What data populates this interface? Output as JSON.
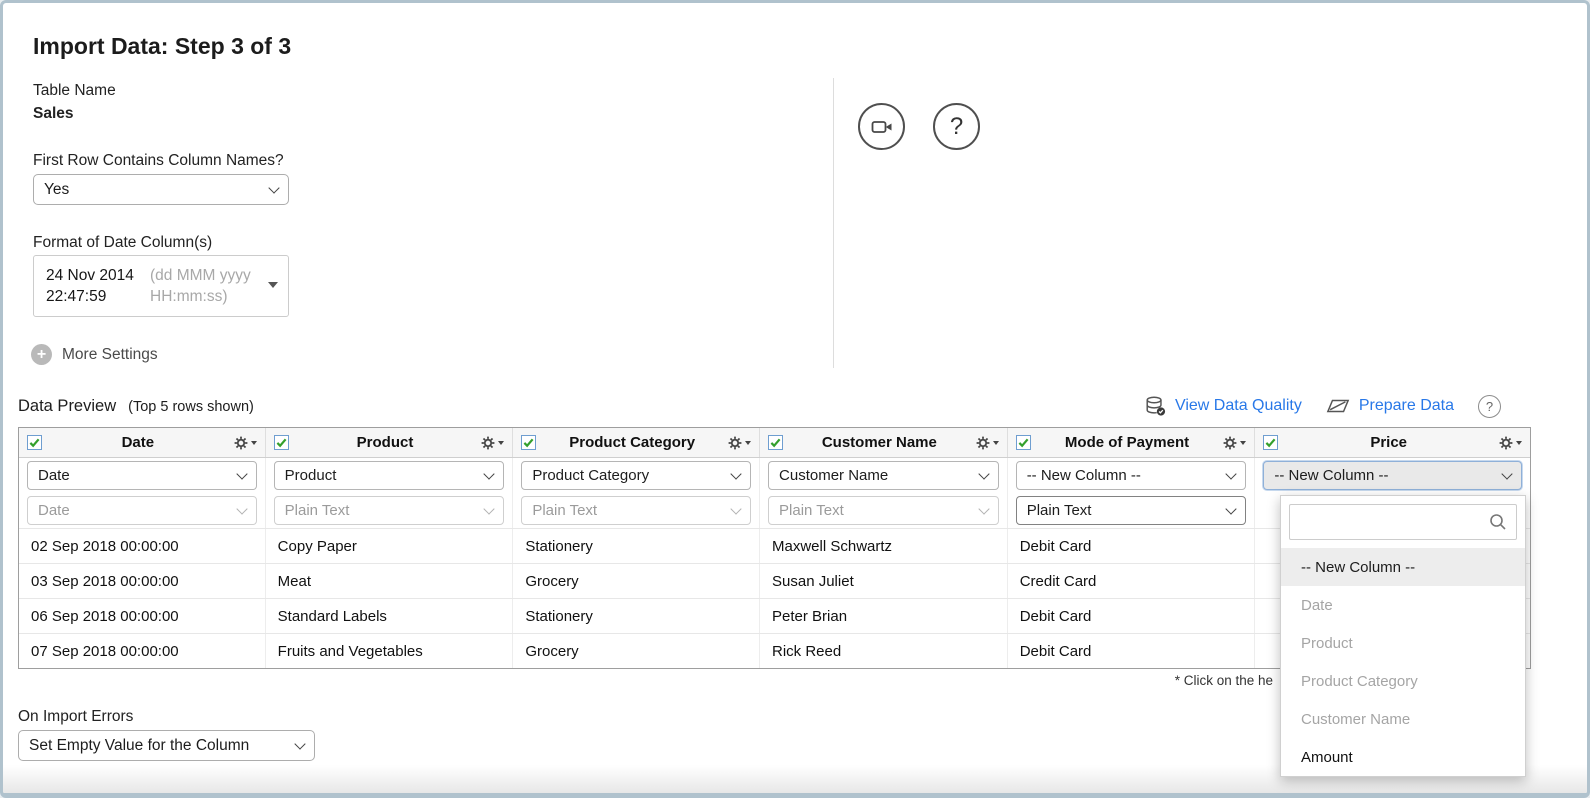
{
  "page": {
    "title": "Import Data: Step 3 of 3"
  },
  "settings": {
    "table_name_label": "Table Name",
    "table_name_value": "Sales",
    "first_row_label": "First Row Contains Column Names?",
    "first_row_value": "Yes",
    "date_format_label": "Format of Date Column(s)",
    "date_value_line1": "24 Nov 2014",
    "date_value_line2": "22:47:59",
    "date_pattern_line1": "(dd MMM yyyy",
    "date_pattern_line2": "HH:mm:ss)",
    "more_settings_label": "More Settings"
  },
  "help": {
    "question_mark": "?",
    "small_question_mark": "?"
  },
  "preview": {
    "title": "Data Preview",
    "subtitle": "(Top 5 rows shown)",
    "view_data_quality_label": "View Data Quality",
    "prepare_data_label": "Prepare Data",
    "footnote": "* Click on the he"
  },
  "table": {
    "columns": [
      {
        "title": "Date",
        "mapping": "Date",
        "type": "Date"
      },
      {
        "title": "Product",
        "mapping": "Product",
        "type": "Plain Text"
      },
      {
        "title": "Product Category",
        "mapping": "Product Category",
        "type": "Plain Text"
      },
      {
        "title": "Customer Name",
        "mapping": "Customer Name",
        "type": "Plain Text"
      },
      {
        "title": "Mode of Payment",
        "mapping": "-- New Column --",
        "type": "Plain Text"
      },
      {
        "title": "Price",
        "mapping": "-- New Column --",
        "type": ""
      }
    ],
    "rows": [
      [
        "02 Sep 2018 00:00:00",
        "Copy Paper",
        "Stationery",
        "Maxwell Schwartz",
        "Debit Card",
        ""
      ],
      [
        "03 Sep 2018 00:00:00",
        "Meat",
        "Grocery",
        "Susan Juliet",
        "Credit Card",
        ""
      ],
      [
        "06 Sep 2018 00:00:00",
        "Standard Labels",
        "Stationery",
        "Peter Brian",
        "Debit Card",
        ""
      ],
      [
        "07 Sep 2018 00:00:00",
        "Fruits and Vegetables",
        "Grocery",
        "Rick Reed",
        "Debit Card",
        ""
      ]
    ]
  },
  "dropdown": {
    "search_value": "",
    "options": [
      {
        "label": "-- New Column --",
        "state": "selected"
      },
      {
        "label": "Date",
        "state": "disabled"
      },
      {
        "label": "Product",
        "state": "disabled"
      },
      {
        "label": "Product Category",
        "state": "disabled"
      },
      {
        "label": "Customer Name",
        "state": "disabled"
      },
      {
        "label": "Amount",
        "state": "normal"
      }
    ]
  },
  "import_errors": {
    "label": "On Import Errors",
    "value": "Set Empty Value for the Column"
  },
  "colors": {
    "link_blue": "#2878e8",
    "check_green": "#35a02c",
    "checkbox_border": "#6f9ed0",
    "focus_border": "#8fb0d8"
  }
}
